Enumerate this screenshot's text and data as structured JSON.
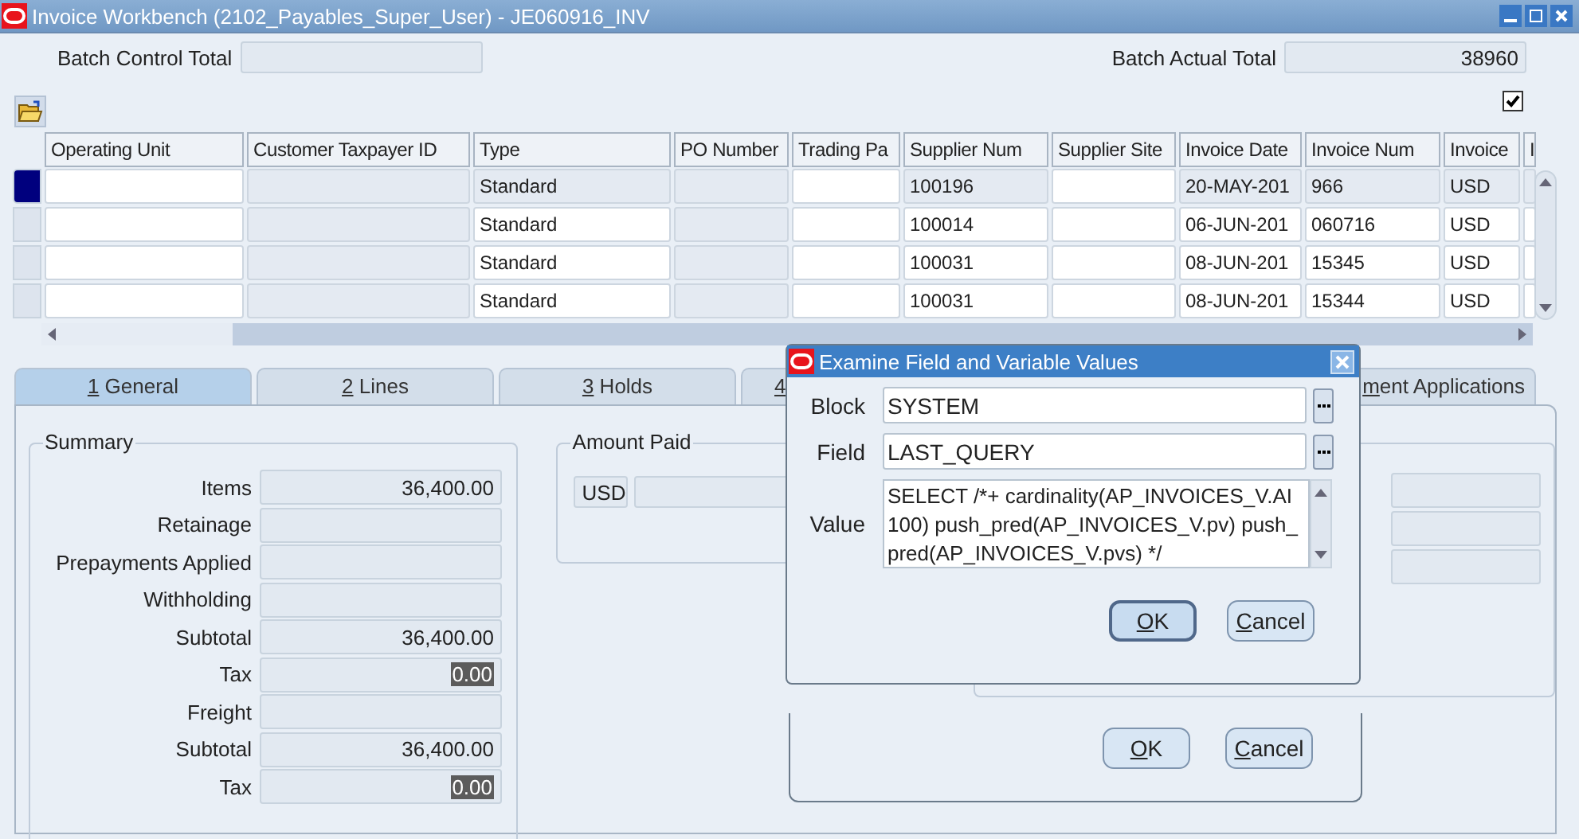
{
  "window": {
    "title": "Invoice Workbench (2102_Payables_Super_User) - JE060916_INV"
  },
  "header": {
    "batch_control_total": {
      "label": "Batch Control Total"
    },
    "batch_actual_total": {
      "label": "Batch Actual Total",
      "value": "38960"
    }
  },
  "checkbox": {
    "checked": true
  },
  "table": {
    "columns": [
      "Operating Unit",
      "Customer Taxpayer ID",
      "Type",
      "PO Number",
      "Trading Pa",
      "Supplier Num",
      "Supplier Site",
      "Invoice Date",
      "Invoice Num",
      "Invoice",
      "I"
    ],
    "rows": [
      {
        "selected": true,
        "type": "Standard",
        "supplier_num": "100196",
        "invoice_date": "20-MAY-201",
        "invoice_num": "966",
        "invoice": "USD"
      },
      {
        "selected": false,
        "type": "Standard",
        "supplier_num": "100014",
        "invoice_date": "06-JUN-201",
        "invoice_num": "060716",
        "invoice": "USD"
      },
      {
        "selected": false,
        "type": "Standard",
        "supplier_num": "100031",
        "invoice_date": "08-JUN-201",
        "invoice_num": "15345",
        "invoice": "USD"
      },
      {
        "selected": false,
        "type": "Standard",
        "supplier_num": "100031",
        "invoice_date": "08-JUN-201",
        "invoice_num": "15344",
        "invoice": "USD"
      }
    ]
  },
  "tabs": [
    {
      "label": "1 General",
      "selected": true
    },
    {
      "label": "2 Lines",
      "selected": false
    },
    {
      "label": "3 Holds",
      "selected": false
    },
    {
      "label": "4",
      "selected": false
    },
    {
      "label": "ment Applications",
      "selected": false
    }
  ],
  "summary": {
    "title": "Summary",
    "rows": [
      {
        "label": "Items",
        "value": "36,400.00",
        "highlighted": false
      },
      {
        "label": "Retainage"
      },
      {
        "label": "Prepayments Applied"
      },
      {
        "label": "Withholding"
      },
      {
        "label": "Subtotal",
        "value": "36,400.00",
        "highlighted": false
      },
      {
        "label": "Tax",
        "value": "0.00",
        "highlighted": true
      },
      {
        "label": "Freight"
      },
      {
        "label": "Subtotal",
        "value": "36,400.00",
        "highlighted": false
      },
      {
        "label": "Tax",
        "value": "0.00",
        "highlighted": true
      }
    ]
  },
  "amount_paid": {
    "title": "Amount Paid",
    "currency": "USD"
  },
  "dialog": {
    "title": "Examine Field and Variable Values",
    "block": {
      "label": "Block",
      "value": "SYSTEM"
    },
    "field": {
      "label": "Field",
      "value": "LAST_QUERY"
    },
    "value": {
      "label": "Value",
      "value": "SELECT /*+ cardinality(AP_INVOICES_V.AI 100) push_pred(AP_INVOICES_V.pv) push_pred(AP_INVOICES_V.pvs) */"
    },
    "buttons": [
      "OK",
      "Cancel"
    ]
  },
  "ghost_dialog": {
    "buttons": [
      "OK",
      "Cancel"
    ]
  }
}
